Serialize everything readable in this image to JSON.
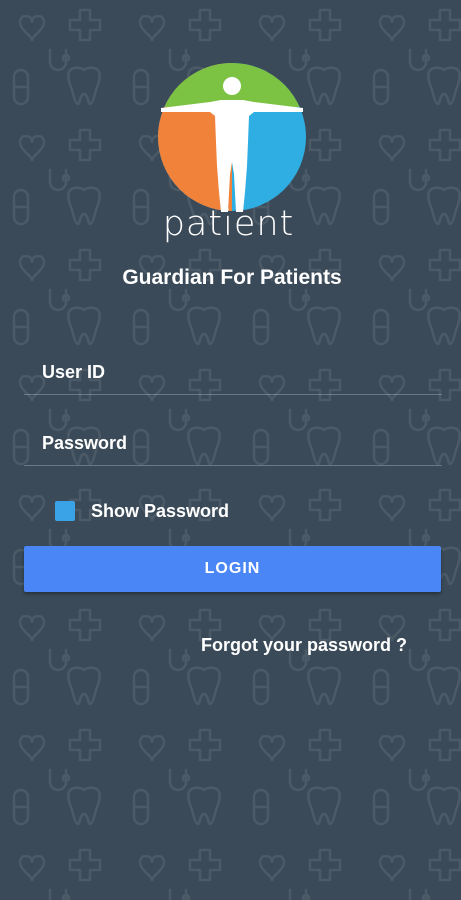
{
  "app": {
    "brand_text": "patient",
    "title": "Guardian For Patients"
  },
  "login_form": {
    "user_id": {
      "placeholder": "User ID",
      "value": ""
    },
    "password": {
      "placeholder": "Password",
      "value": ""
    },
    "show_password_label": "Show Password",
    "show_password_checked": true,
    "login_button_label": "LOGIN",
    "forgot_password_link": "Forgot your password ?"
  },
  "icons": {
    "logo": "patient-logo-icon",
    "background": "medical-pattern-background"
  },
  "colors": {
    "background": "#3a4a58",
    "login_button": "#4a86f5",
    "checkbox": "#3aa3e8",
    "logo_green": "#7cc243",
    "logo_orange": "#f0823a",
    "logo_blue": "#2faee3"
  }
}
